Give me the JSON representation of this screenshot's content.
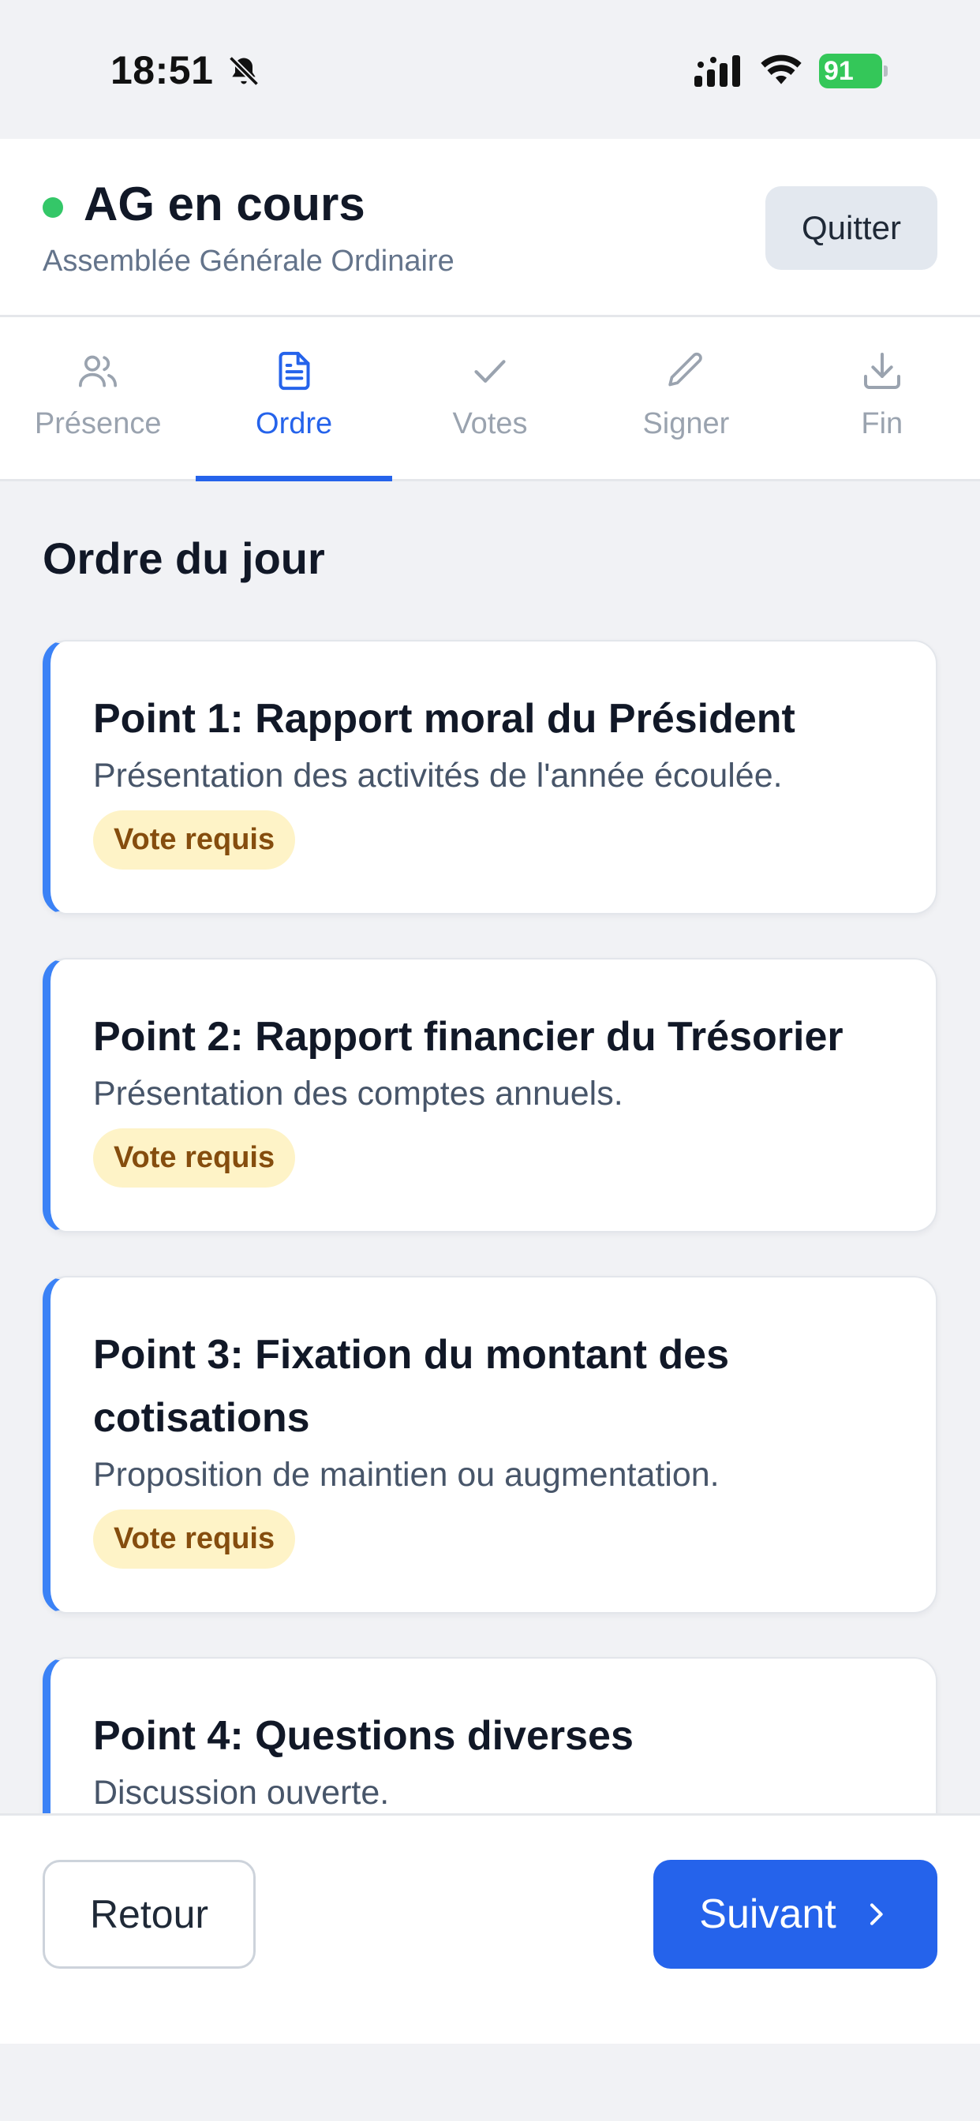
{
  "status_bar": {
    "time": "18:51",
    "battery": "91",
    "icons": [
      "bell-slash-icon",
      "signal-icon",
      "wifi-icon",
      "battery-icon"
    ]
  },
  "header": {
    "title": "AG en cours",
    "subtitle": "Assemblée Générale Ordinaire",
    "quit_label": "Quitter",
    "status_color": "#34c768"
  },
  "tabs": [
    {
      "label": "Présence",
      "icon": "users-icon",
      "active": false
    },
    {
      "label": "Ordre",
      "icon": "document-icon",
      "active": true
    },
    {
      "label": "Votes",
      "icon": "check-icon",
      "active": false
    },
    {
      "label": "Signer",
      "icon": "pencil-icon",
      "active": false
    },
    {
      "label": "Fin",
      "icon": "download-icon",
      "active": false
    }
  ],
  "agenda": {
    "title": "Ordre du jour",
    "items": [
      {
        "title": "Point 1: Rapport moral du Président",
        "description": "Présentation des activités de l'année écoulée.",
        "badge": "Vote requis"
      },
      {
        "title": "Point 2: Rapport financier du Trésorier",
        "description": "Présentation des comptes annuels.",
        "badge": "Vote requis"
      },
      {
        "title": "Point 3: Fixation du montant des cotisations",
        "description": "Proposition de maintien ou augmentation.",
        "badge": "Vote requis"
      },
      {
        "title": "Point 4: Questions diverses",
        "description": "Discussion ouverte."
      }
    ]
  },
  "footer": {
    "back_label": "Retour",
    "next_label": "Suivant"
  },
  "colors": {
    "accent": "#2563eb",
    "card_border_accent": "#3b82f6",
    "badge_bg": "#fef3c7",
    "badge_text": "#854d0e"
  }
}
